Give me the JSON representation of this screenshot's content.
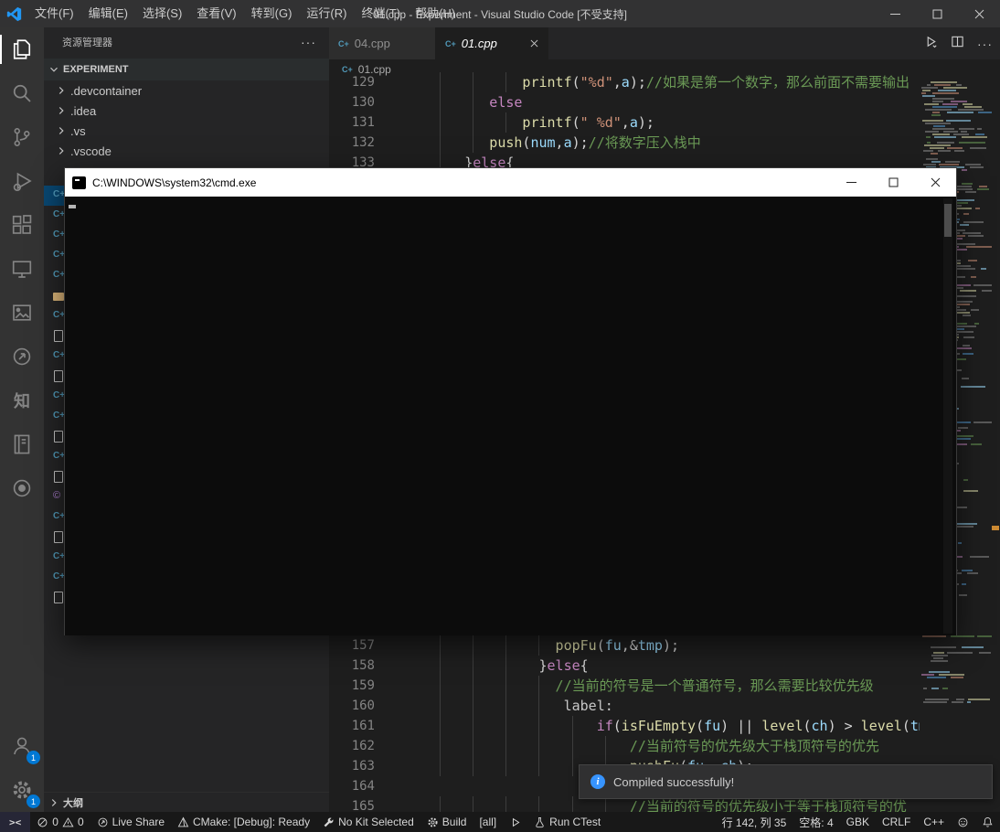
{
  "icons": {
    "cpp": "C+",
    "license": "©",
    "zhihu": "知",
    "remote": "><",
    "more": "···",
    "info": "i"
  },
  "window": {
    "title": "01.cpp - Experiment - Visual Studio Code [不受支持]",
    "menu_items": [
      "文件(F)",
      "编辑(E)",
      "选择(S)",
      "查看(V)",
      "转到(G)",
      "运行(R)",
      "终端(T)",
      "帮助(H)"
    ]
  },
  "activity_bar": {
    "account_badge": "1",
    "settings_badge": "1"
  },
  "sidebar": {
    "title": "资源管理器",
    "section": "EXPERIMENT",
    "items": [
      ".devcontainer",
      ".idea",
      ".vs",
      ".vscode"
    ],
    "slivers": [
      "cpp-selected",
      "cpp",
      "cpp",
      "cpp",
      "cpp",
      "folder",
      "cpp",
      "file",
      "cpp",
      "file",
      "cpp",
      "cpp",
      "file",
      "cpp",
      "file",
      "license",
      "cpp",
      "file",
      "cpp",
      "cpp",
      "file"
    ],
    "outline": "大纲"
  },
  "tabs": [
    {
      "label": "04.cpp"
    },
    {
      "label": "01.cpp"
    }
  ],
  "breadcrumb": {
    "file": "01.cpp"
  },
  "editor": {
    "lines": [
      {
        "num": 129,
        "indent": 14,
        "tokens": [
          [
            "printf",
            "fn"
          ],
          [
            "(",
            "pn"
          ],
          [
            "\"%d\"",
            "str"
          ],
          [
            ",",
            "pn"
          ],
          [
            "a",
            "var"
          ],
          [
            ");",
            "pn"
          ],
          [
            "//如果是第一个数字，那么前面不需要输出",
            "cm"
          ]
        ]
      },
      {
        "num": 130,
        "indent": 10,
        "tokens": [
          [
            "else",
            "kw"
          ]
        ]
      },
      {
        "num": 131,
        "indent": 14,
        "tokens": [
          [
            "printf",
            "fn"
          ],
          [
            "(",
            "pn"
          ],
          [
            "\" %d\"",
            "str"
          ],
          [
            ",",
            "pn"
          ],
          [
            "a",
            "var"
          ],
          [
            ");",
            "pn"
          ]
        ]
      },
      {
        "num": 132,
        "indent": 10,
        "tokens": [
          [
            "push",
            "fn"
          ],
          [
            "(",
            "pn"
          ],
          [
            "num",
            "var"
          ],
          [
            ",",
            "pn"
          ],
          [
            "a",
            "var"
          ],
          [
            ");",
            "pn"
          ],
          [
            "//将数字压入栈中",
            "cm"
          ]
        ]
      },
      {
        "num": 133,
        "indent": 7,
        "tokens": [
          [
            "}",
            "pn"
          ],
          [
            "else",
            "kw"
          ],
          [
            "{",
            "pn"
          ]
        ]
      },
      {
        "num": 157,
        "indent": 18,
        "tokens": [
          [
            "popFu",
            "fn"
          ],
          [
            "(",
            "pn"
          ],
          [
            "fu",
            "var"
          ],
          [
            ",&",
            "pn"
          ],
          [
            "tmp",
            "var"
          ],
          [
            ");",
            "pn"
          ]
        ]
      },
      {
        "num": 158,
        "indent": 16,
        "tokens": [
          [
            "}",
            "pn"
          ],
          [
            "else",
            "kw"
          ],
          [
            "{",
            "pn"
          ]
        ]
      },
      {
        "num": 159,
        "indent": 18,
        "tokens": [
          [
            "//当前的符号是一个普通符号，那么需要比较优先级",
            "cm"
          ]
        ]
      },
      {
        "num": 160,
        "indent": 19,
        "tokens": [
          [
            "label:",
            "lbl"
          ]
        ]
      },
      {
        "num": 161,
        "indent": 23,
        "tokens": [
          [
            "if",
            "kw"
          ],
          [
            "(",
            "pn"
          ],
          [
            "isFuEmpty",
            "fn"
          ],
          [
            "(",
            "pn"
          ],
          [
            "fu",
            "var"
          ],
          [
            ")",
            "pn"
          ],
          [
            " || ",
            "pn"
          ],
          [
            "level",
            "fn"
          ],
          [
            "(",
            "pn"
          ],
          [
            "ch",
            "var"
          ],
          [
            ")",
            "pn"
          ],
          [
            " > ",
            "pn"
          ],
          [
            "level",
            "fn"
          ],
          [
            "(",
            "pn"
          ],
          [
            "tm",
            "var"
          ]
        ]
      },
      {
        "num": 162,
        "indent": 27,
        "tokens": [
          [
            "//当前符号的优先级大于栈顶符号的优先",
            "cm"
          ]
        ]
      },
      {
        "num": 163,
        "indent": 27,
        "tokens": [
          [
            "pushFu",
            "fn"
          ],
          [
            "(",
            "pn"
          ],
          [
            "fu",
            "var"
          ],
          [
            ", ",
            "pn"
          ],
          [
            "ch",
            "var"
          ],
          [
            ");",
            "pn"
          ]
        ]
      },
      {
        "num": 164,
        "indent": 0,
        "tokens": []
      },
      {
        "num": 165,
        "indent": 27,
        "tokens": [
          [
            "//当前的符号的优先级小于等于栈顶符号的优",
            "cm"
          ]
        ]
      }
    ]
  },
  "cmd_window": {
    "title": "C:\\WINDOWS\\system32\\cmd.exe"
  },
  "notification": {
    "message": "Compiled successfully!"
  },
  "status_bar": {
    "errors": "0",
    "warnings": "0",
    "live_share": "Live Share",
    "cmake": "CMake: [Debug]: Ready",
    "kit": "No Kit Selected",
    "build": "Build",
    "target": "[all]",
    "ctest": "Run CTest",
    "cursor": "行 142, 列 35",
    "spaces": "空格: 4",
    "encoding": "GBK",
    "eol": "CRLF",
    "language": "C++"
  }
}
